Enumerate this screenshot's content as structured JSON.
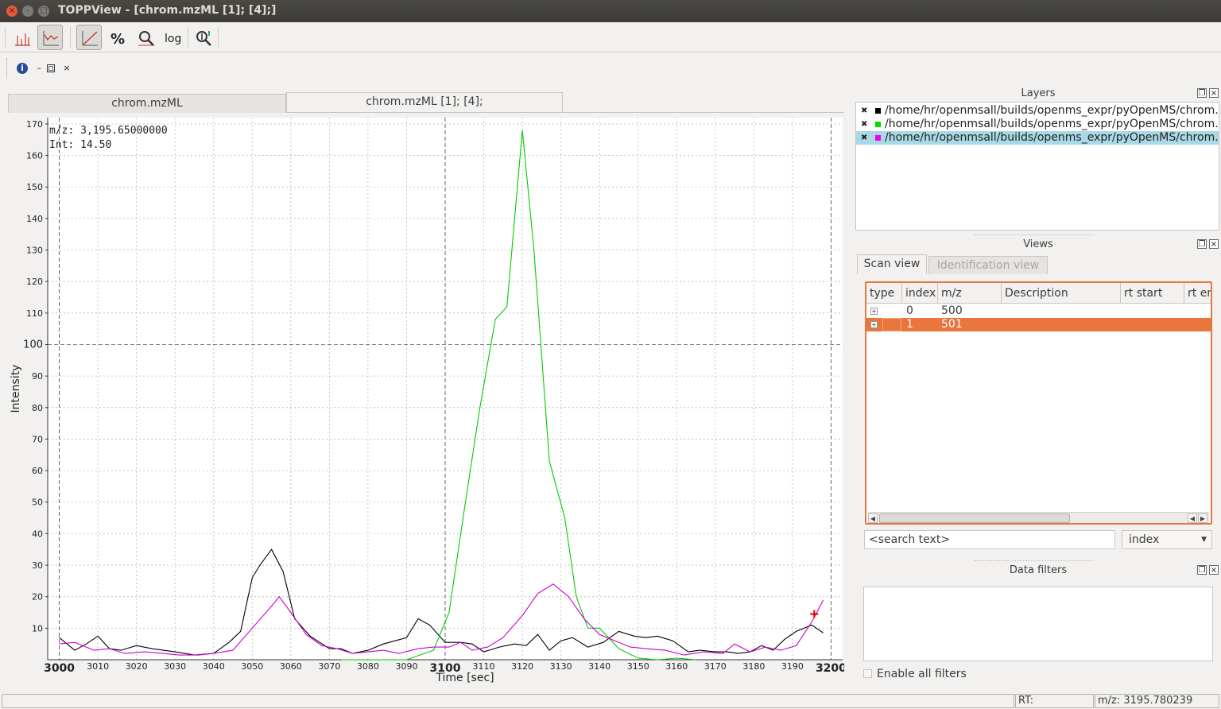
{
  "window": {
    "title": "TOPPView - [chrom.mzML [1]; [4];]",
    "close_glyph": "×",
    "min_glyph": "–",
    "max_glyph": "□"
  },
  "toolbar": {
    "buttons": [
      "peak-mode-icon",
      "chrom-mode-icon",
      "linear-intensity-icon",
      "percent-icon",
      "snap-zoom-icon",
      "log-icon",
      "reset-zoom-icon"
    ],
    "log_label": "log",
    "percent_label": "%"
  },
  "subbar": {
    "info_glyph": "i",
    "min_glyph": "–",
    "restore_glyph": "▫",
    "close_glyph": "×"
  },
  "doc_tabs": [
    {
      "label": "chrom.mzML"
    },
    {
      "label": "chrom.mzML [1]; [4];"
    }
  ],
  "plot": {
    "info_mz": "m/z: 3,195.65000000",
    "info_int": "Int: 14.50",
    "xlabel": "Time [sec]",
    "ylabel": "Intensity",
    "colors": {
      "black": "#000000",
      "green": "#00cc00",
      "magenta": "#cc00cc",
      "cursor": "#dd0000"
    }
  },
  "chart_data": {
    "type": "line",
    "xlabel": "Time [sec]",
    "ylabel": "Intensity",
    "xlim": [
      2997,
      3203
    ],
    "ylim": [
      0,
      172
    ],
    "x_major_ticks": [
      3000,
      3100,
      3200
    ],
    "x_minor_ticks": [
      3010,
      3020,
      3030,
      3040,
      3050,
      3060,
      3070,
      3080,
      3090,
      3110,
      3120,
      3130,
      3140,
      3150,
      3160,
      3170,
      3180,
      3190
    ],
    "y_ticks": [
      10,
      20,
      30,
      40,
      50,
      60,
      70,
      80,
      90,
      100,
      110,
      120,
      130,
      140,
      150,
      160,
      170
    ],
    "grid": true,
    "series": [
      {
        "color": "#000000",
        "x": [
          3000,
          3004,
          3007,
          3010,
          3013,
          3016,
          3020,
          3024,
          3027,
          3030,
          3035,
          3040,
          3044,
          3047,
          3050,
          3052,
          3055,
          3058,
          3061,
          3065,
          3070,
          3073,
          3076,
          3080,
          3084,
          3087,
          3090,
          3093,
          3096,
          3100,
          3104,
          3107,
          3110,
          3114,
          3118,
          3121,
          3124,
          3127,
          3130,
          3133,
          3137,
          3141,
          3145,
          3149,
          3152,
          3155,
          3159,
          3163,
          3166,
          3170,
          3173,
          3176,
          3179,
          3182,
          3185,
          3188,
          3191,
          3195,
          3198
        ],
        "y": [
          7,
          3,
          5,
          7.5,
          3.5,
          3,
          4.5,
          3.5,
          3,
          2.5,
          1.5,
          2,
          5.5,
          9,
          26,
          30,
          35,
          28,
          13,
          7.5,
          3.5,
          3.5,
          2,
          3,
          5,
          6,
          7,
          13,
          11,
          5.5,
          5.5,
          5,
          2.5,
          4,
          5,
          4.5,
          8,
          3,
          6,
          7,
          4,
          5.5,
          9,
          7.5,
          7,
          7.5,
          6,
          2.5,
          3,
          2.5,
          2.5,
          2,
          2.5,
          4.5,
          3,
          6.5,
          9,
          11,
          8.5
        ]
      },
      {
        "color": "#00cc00",
        "x": [
          3073,
          3090,
          3097,
          3101,
          3105,
          3109,
          3113,
          3116,
          3120,
          3123,
          3127,
          3131,
          3134,
          3137,
          3140,
          3145,
          3150,
          3155,
          3160,
          3165
        ],
        "y": [
          0,
          0,
          3,
          15,
          48,
          80,
          108,
          112,
          168,
          130,
          63,
          45,
          20,
          10,
          10,
          3.5,
          0.5,
          0,
          0.5,
          0
        ]
      },
      {
        "color": "#cc00cc",
        "x": [
          3000,
          3004,
          3009,
          3013,
          3017,
          3022,
          3027,
          3031,
          3036,
          3040,
          3045,
          3050,
          3055,
          3057,
          3060,
          3064,
          3068,
          3072,
          3076,
          3080,
          3084,
          3088,
          3093,
          3097,
          3101,
          3104,
          3107,
          3111,
          3115,
          3120,
          3124,
          3128,
          3132,
          3136,
          3140,
          3144,
          3148,
          3152,
          3157,
          3162,
          3167,
          3172,
          3175,
          3179,
          3183,
          3187,
          3191,
          3195,
          3198
        ],
        "y": [
          5,
          5.5,
          3,
          3.5,
          2,
          2.5,
          2,
          1.5,
          1.5,
          2,
          3,
          10,
          17,
          20,
          15,
          8,
          4.5,
          3.5,
          2,
          2.5,
          3,
          2,
          3.5,
          4,
          4,
          5.5,
          3,
          4,
          7,
          14,
          21,
          24,
          20,
          13,
          8,
          6,
          4,
          3.5,
          3,
          1.5,
          2.5,
          2,
          5,
          2.5,
          4,
          3,
          4.5,
          12,
          19
        ]
      }
    ],
    "cursor": {
      "x": 3195.65,
      "y": 14.5
    }
  },
  "layers": {
    "title": "Layers",
    "items": [
      {
        "path": "/home/hr/openmsall/builds/openms_expr/pyOpenMS/chrom.mzML",
        "color": "#000000",
        "checked": "✖"
      },
      {
        "path": "/home/hr/openmsall/builds/openms_expr/pyOpenMS/chrom.mzML",
        "color": "#00dd00",
        "checked": "✖"
      },
      {
        "path": "/home/hr/openmsall/builds/openms_expr/pyOpenMS/chrom.mzML",
        "color": "#ee00ee",
        "checked": "✖"
      }
    ]
  },
  "views": {
    "title": "Views",
    "tabs": [
      "Scan view",
      "Identification view"
    ],
    "columns": [
      "type",
      "index",
      "m/z",
      "Description",
      "rt start",
      "rt end"
    ],
    "rows": [
      {
        "expand": "+",
        "index": "0",
        "mz": "500"
      },
      {
        "expand": "+",
        "index": "1",
        "mz": "501"
      }
    ],
    "search_placeholder": "<search text>",
    "search_field": "index",
    "left_arrow": "◀",
    "right_arrow": "▶",
    "left_arrow2": "◀"
  },
  "data_filters": {
    "title": "Data filters",
    "enable_label": "Enable all filters"
  },
  "dock_buttons": {
    "float": "❐",
    "close": "×"
  },
  "statusbar": {
    "rt": "RT:",
    "mz": "m/z: 3195.780239"
  }
}
